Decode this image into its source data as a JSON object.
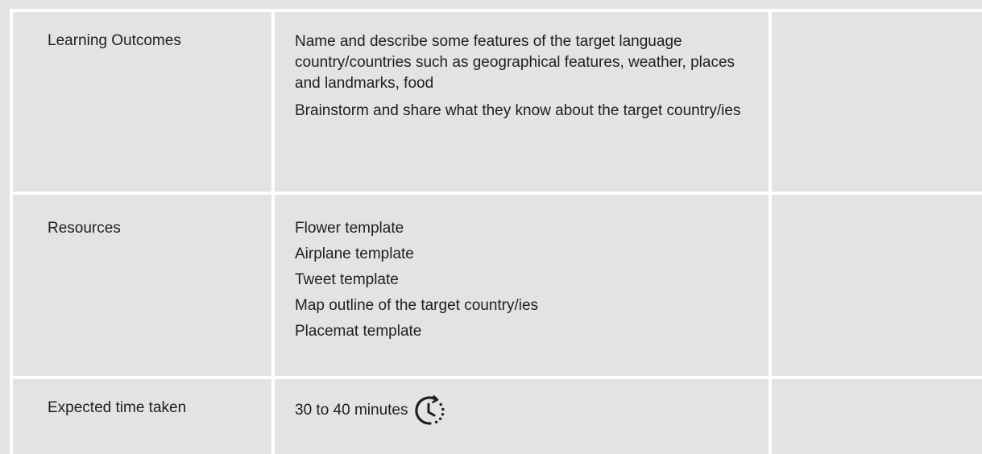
{
  "rows": [
    {
      "label": "Learning Outcomes",
      "paragraphs": [
        "Name and describe some features of the target language country/countries such as geographical features, weather, places and landmarks, food",
        "Brainstorm and share what they know about the target country/ies"
      ]
    },
    {
      "label": "Resources",
      "items": [
        "Flower template",
        "Airplane template",
        "Tweet template",
        "Map outline of the target country/ies",
        "Placemat template"
      ]
    },
    {
      "label": "Expected time taken",
      "value": "30 to 40 minutes",
      "icon": "clock-icon"
    }
  ]
}
